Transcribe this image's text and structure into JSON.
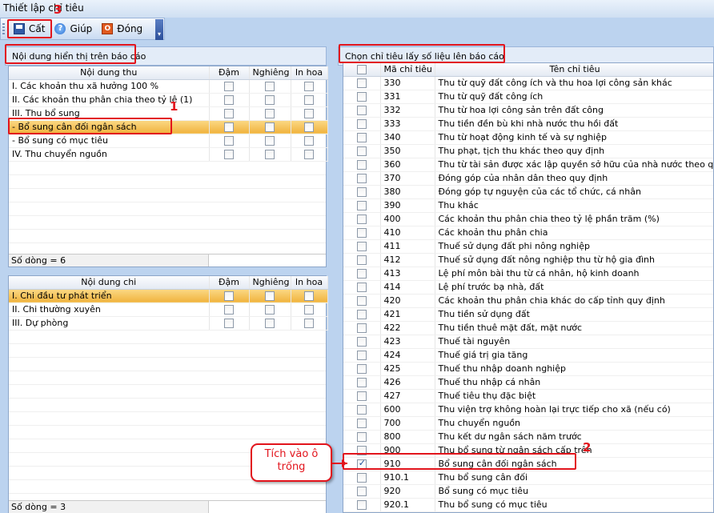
{
  "window": {
    "title": "Thiết lập chỉ tiêu"
  },
  "toolbar": {
    "save_label": "Cất",
    "help_label": "Giúp",
    "close_label": "Đóng"
  },
  "annotations": {
    "n1": "1",
    "n2": "2",
    "n3": "3",
    "callout": "Tích vào ô trống"
  },
  "left_panel": {
    "header": "Nội dung hiển thị trên báo cáo",
    "income": {
      "columns": [
        "Nội dung thu",
        "Đậm",
        "Nghiêng",
        "In hoa"
      ],
      "rows": [
        {
          "label": "I. Các khoản thu xã hưởng 100 %"
        },
        {
          "label": "II. Các khoản thu phân chia theo tỷ lệ (1)"
        },
        {
          "label": "III. Thu bổ sung"
        },
        {
          "label": "- Bổ sung cân đối ngân sách",
          "selected": true
        },
        {
          "label": "- Bổ sung có mục tiêu"
        },
        {
          "label": "IV. Thu chuyển nguồn"
        }
      ],
      "footer": "Số dòng = 6"
    },
    "expense": {
      "columns": [
        "Nội dung chi",
        "Đậm",
        "Nghiêng",
        "In hoa"
      ],
      "rows": [
        {
          "label": "I. Chi đầu tư phát triển",
          "selected": true
        },
        {
          "label": "II. Chi thường xuyên"
        },
        {
          "label": "III. Dự phòng"
        }
      ],
      "footer": "Số dòng = 3"
    }
  },
  "right_panel": {
    "header": "Chọn chỉ tiêu lấy số liệu lên báo cáo",
    "columns": [
      "Mã chỉ tiêu",
      "Tên chỉ tiêu"
    ],
    "rows": [
      {
        "code": "330",
        "name": "Thu từ quỹ đất công ích và thu hoa lợi công sản khác",
        "checked": false
      },
      {
        "code": "331",
        "name": "Thu từ quỹ đất công ích",
        "checked": false
      },
      {
        "code": "332",
        "name": "Thu từ hoa lợi công sản trên đất công",
        "checked": false
      },
      {
        "code": "333",
        "name": "Thu tiền đền bù khi nhà nước thu hồi đất",
        "checked": false
      },
      {
        "code": "340",
        "name": "Thu từ hoạt động kinh tế và sự nghiệp",
        "checked": false
      },
      {
        "code": "350",
        "name": "Thu phạt, tịch thu khác theo quy định",
        "checked": false
      },
      {
        "code": "360",
        "name": "Thu từ tài sản được xác lập quyền sở hữu của nhà nước theo quy định",
        "checked": false
      },
      {
        "code": "370",
        "name": "Đóng góp của nhân dân theo quy định",
        "checked": false
      },
      {
        "code": "380",
        "name": "Đóng góp tự nguyện của các tổ chức, cá nhân",
        "checked": false
      },
      {
        "code": "390",
        "name": "Thu khác",
        "checked": false
      },
      {
        "code": "400",
        "name": "Các khoản thu phân chia theo tỷ lệ phần trăm (%)",
        "checked": false
      },
      {
        "code": "410",
        "name": "Các khoản thu phân chia",
        "checked": false
      },
      {
        "code": "411",
        "name": "Thuế sử dụng đất phi nông nghiệp",
        "checked": false
      },
      {
        "code": "412",
        "name": "Thuế sử dụng đất nông nghiệp thu từ hộ gia đình",
        "checked": false
      },
      {
        "code": "413",
        "name": "Lệ phí môn bài thu từ cá nhân, hộ kinh doanh",
        "checked": false
      },
      {
        "code": "414",
        "name": "Lệ phí trước bạ nhà, đất",
        "checked": false
      },
      {
        "code": "420",
        "name": "Các khoản thu phân chia khác do cấp tỉnh quy định",
        "checked": false
      },
      {
        "code": "421",
        "name": "Thu tiền sử dụng đất",
        "checked": false
      },
      {
        "code": "422",
        "name": "Thu tiền thuê mặt đất, mặt nước",
        "checked": false
      },
      {
        "code": "423",
        "name": "Thuế tài nguyên",
        "checked": false
      },
      {
        "code": "424",
        "name": "Thuế giá trị gia tăng",
        "checked": false
      },
      {
        "code": "425",
        "name": "Thuế thu nhập doanh nghiệp",
        "checked": false
      },
      {
        "code": "426",
        "name": "Thuế thu nhập cá nhân",
        "checked": false
      },
      {
        "code": "427",
        "name": "Thuế tiêu thụ đặc biệt",
        "checked": false
      },
      {
        "code": "600",
        "name": "Thu viện trợ không hoàn lại trực tiếp cho xã (nếu có)",
        "checked": false
      },
      {
        "code": "700",
        "name": "Thu chuyển nguồn",
        "checked": false
      },
      {
        "code": "800",
        "name": "Thu kết dư ngân sách năm trước",
        "checked": false
      },
      {
        "code": "900",
        "name": "Thu bổ sung từ ngân sách cấp trên",
        "checked": false
      },
      {
        "code": "910",
        "name": "Bổ sung cân đối ngân sách",
        "checked": true
      },
      {
        "code": "910.1",
        "name": "Thu bổ sung cân đối",
        "checked": false
      },
      {
        "code": "920",
        "name": "Bổ sung có mục tiêu",
        "checked": false
      },
      {
        "code": "920.1",
        "name": "Thu bổ sung có mục tiêu",
        "checked": false
      }
    ]
  },
  "colors": {
    "highlight": "#f0b33e",
    "annotation": "#e2141c"
  }
}
